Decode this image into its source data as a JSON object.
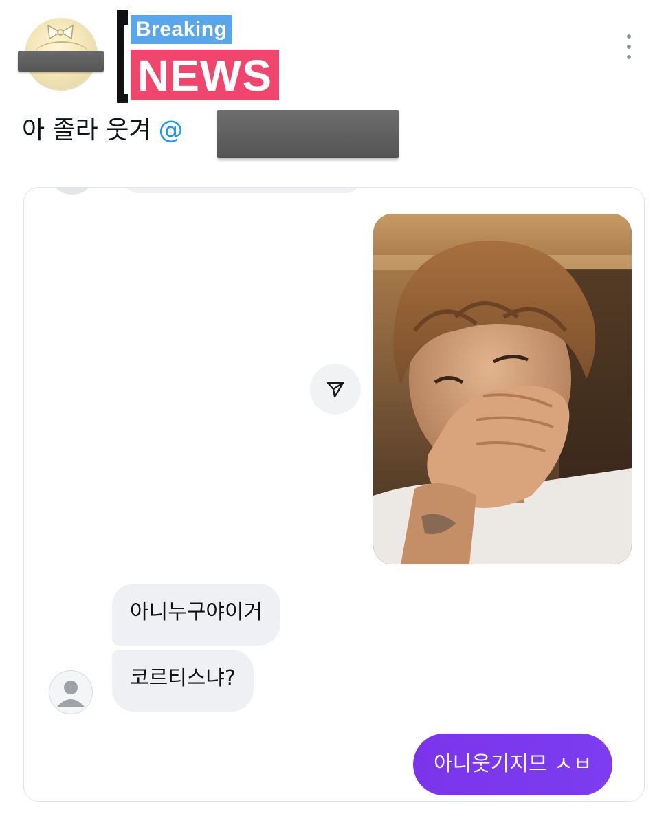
{
  "tweet": {
    "text": "아 졸라 웃겨",
    "mention": "@"
  },
  "header_image": {
    "line1": "Breaking",
    "line2": "NEWS",
    "colors": {
      "line1_bg": "#5aa6ea",
      "line2_bg": "#f0466e",
      "text": "#ffffff"
    }
  },
  "icons": {
    "more": "more-vertical-icon",
    "share": "send-paper-plane-icon",
    "contact": "default-user-avatar-icon"
  },
  "chat": {
    "incoming": [
      {
        "text": "아니누구야이거"
      },
      {
        "text": "코르티스냐?"
      }
    ],
    "outgoing": [
      {
        "text": "아니웃기지므 ㅅㅂ"
      }
    ],
    "colors": {
      "incoming_bg": "#eef0f3",
      "outgoing_bg": "#7c3aed",
      "mention": "#1d9bf0"
    }
  }
}
